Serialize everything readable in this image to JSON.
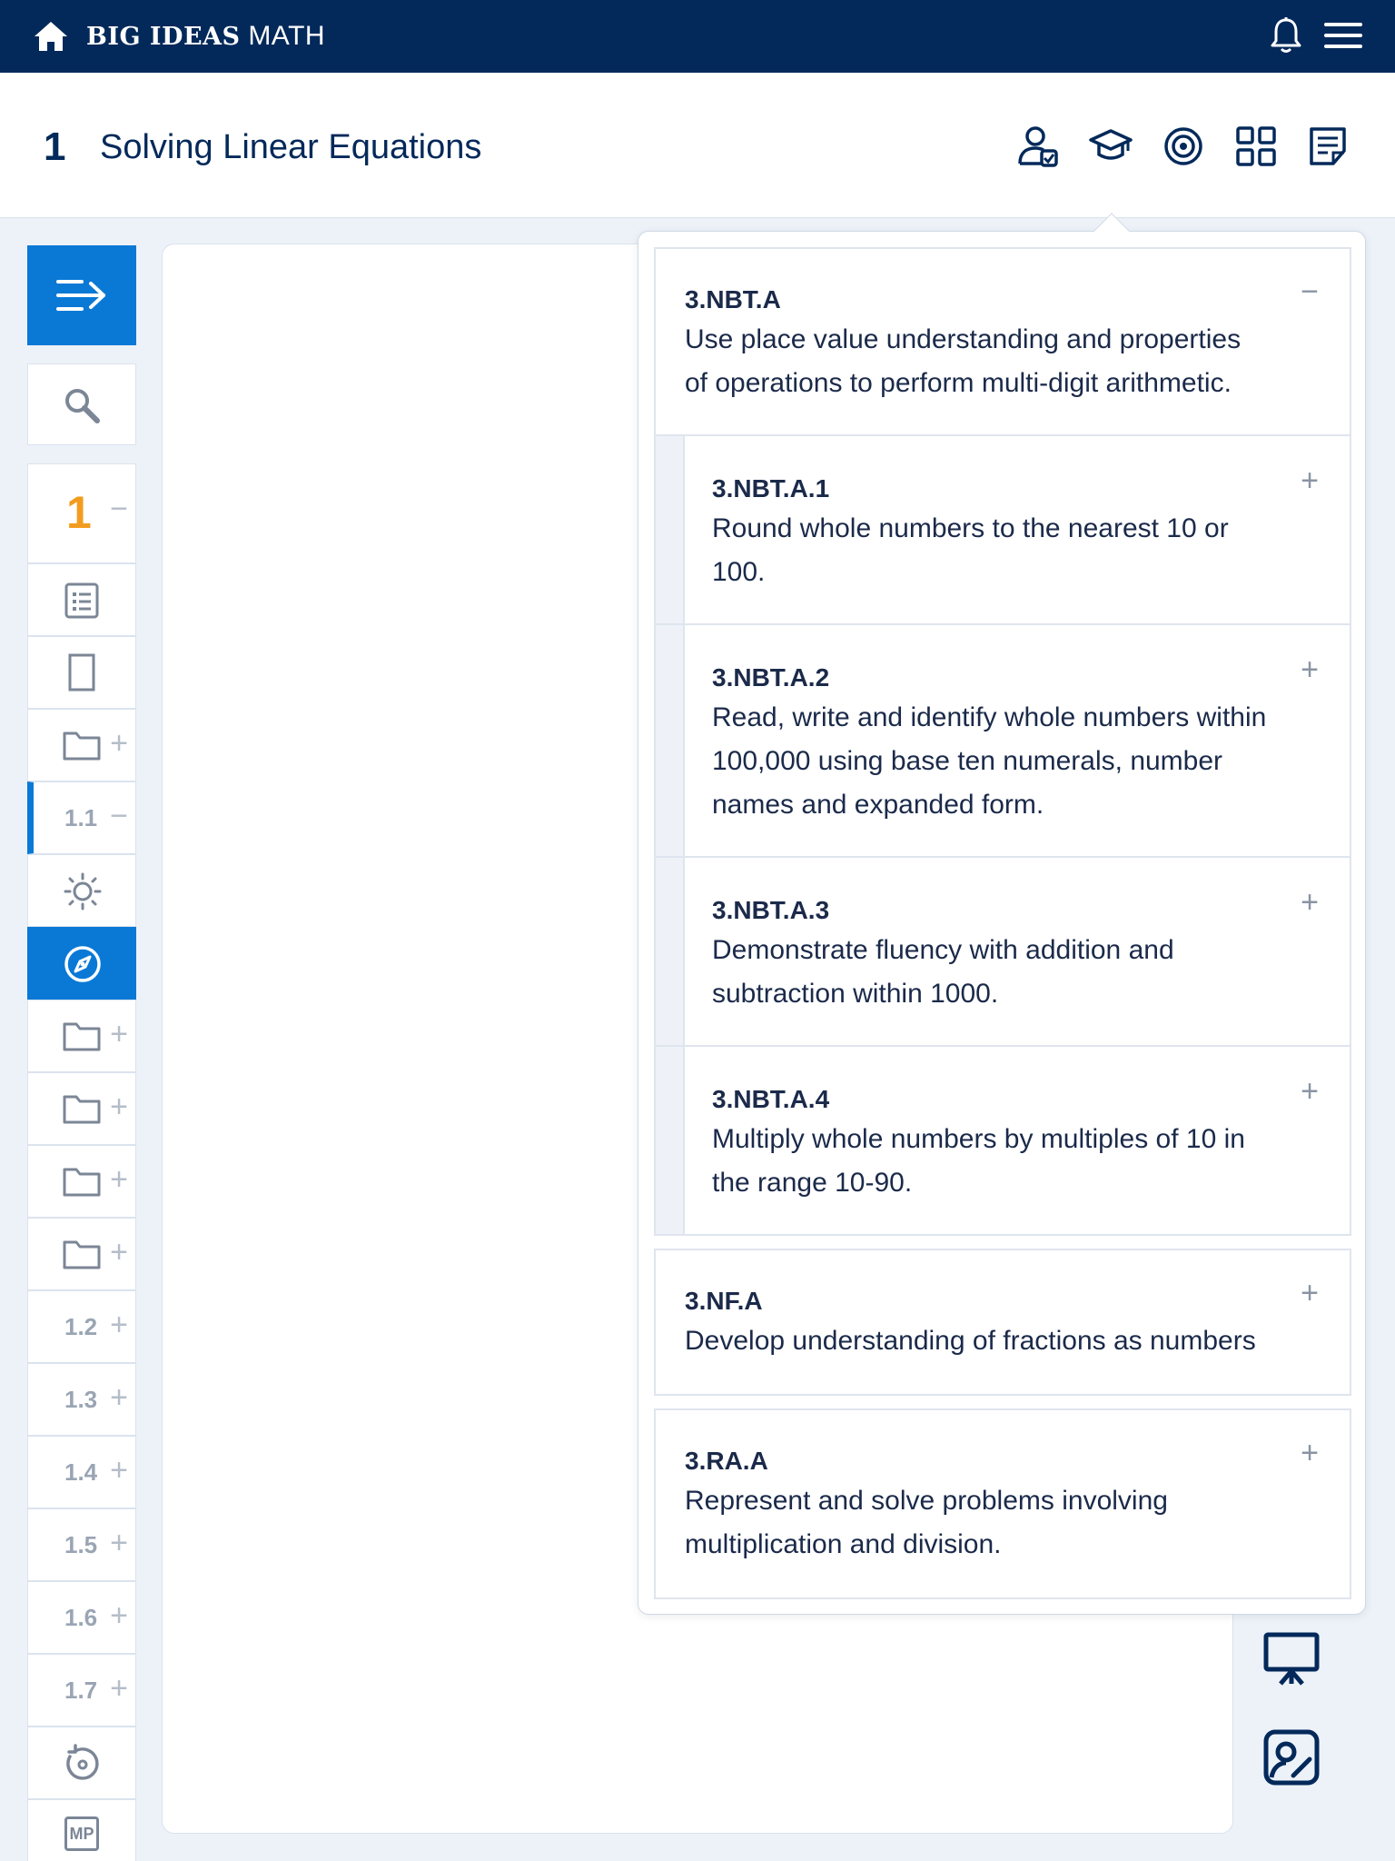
{
  "app": {
    "brand_bold": "BIG IDEAS",
    "brand_rest": " MATH"
  },
  "header": {
    "chapter_number": "1",
    "chapter_title": "Solving Linear Equations"
  },
  "sidebar": {
    "chapter_label": "1",
    "sections": [
      "1.1",
      "1.2",
      "1.3",
      "1.4",
      "1.5",
      "1.6",
      "1.7"
    ],
    "mp_label": "MP"
  },
  "standards": {
    "groups": [
      {
        "code": "3.NBT.A",
        "description": "Use place value understanding and properties of operations to perform multi-digit arithmetic.",
        "toggle": "−"
      },
      {
        "code": "3.NF.A",
        "description": "Develop understanding of fractions as numbers",
        "toggle": "+"
      },
      {
        "code": "3.RA.A",
        "description": "Represent and solve problems involving multiplication and division.",
        "toggle": "+"
      }
    ],
    "subitems": [
      {
        "code": "3.NBT.A.1",
        "description": "Round whole numbers to the nearest 10 or 100.",
        "toggle": "+"
      },
      {
        "code": "3.NBT.A.2",
        "description": "Read, write and identify whole numbers within 100,000 using base ten numerals, number names and expanded form.",
        "toggle": "+"
      },
      {
        "code": "3.NBT.A.3",
        "description": "Demonstrate fluency with addition and subtraction within 1000.",
        "toggle": "+"
      },
      {
        "code": "3.NBT.A.4",
        "description": "Multiply whole numbers by multiples of 10 in the range 10-90.",
        "toggle": "+"
      }
    ]
  },
  "colors": {
    "navy": "#03295a",
    "accent_blue": "#0a79d6",
    "chapter_orange": "#f29c1f"
  }
}
